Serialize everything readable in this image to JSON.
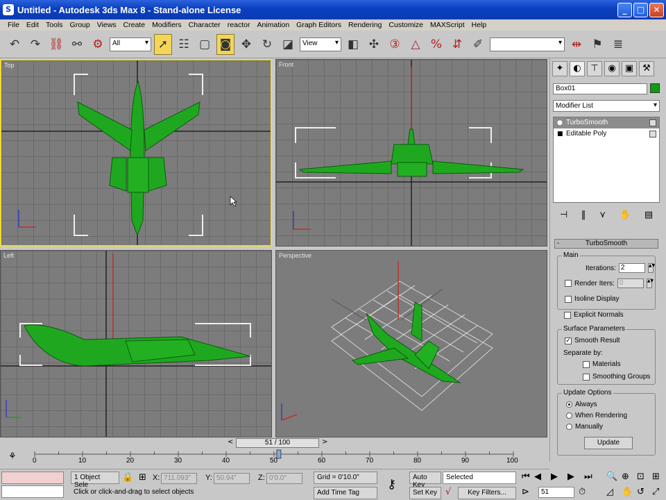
{
  "window": {
    "title": "Untitled - Autodesk 3ds Max 8 - Stand-alone License",
    "minimize": "_",
    "maximize": "□",
    "close": "✕"
  },
  "menu": [
    "File",
    "Edit",
    "Tools",
    "Group",
    "Views",
    "Create",
    "Modifiers",
    "Character",
    "reactor",
    "Animation",
    "Graph Editors",
    "Rendering",
    "Customize",
    "MAXScript",
    "Help"
  ],
  "toolbar": {
    "selection_filter": "All",
    "reference_coord": "View"
  },
  "viewports": {
    "top": "Top",
    "front": "Front",
    "left": "Left",
    "perspective": "Perspective"
  },
  "command_panel": {
    "object_name": "Box01",
    "object_color": "#139a13",
    "modifier_list": "Modifier List",
    "stack": [
      "TurboSmooth",
      "Editable Poly"
    ],
    "rollout_title": "TurboSmooth",
    "main": {
      "label": "Main",
      "iterations_label": "Iterations:",
      "iterations_value": "2",
      "render_iters_label": "Render Iters:",
      "render_iters_value": "0",
      "isoline_display": "Isoline Display",
      "explicit_normals": "Explicit Normals"
    },
    "surface": {
      "label": "Surface Parameters",
      "smooth_result": "Smooth Result",
      "separate_by": "Separate by:",
      "materials": "Materials",
      "smoothing_groups": "Smoothing Groups"
    },
    "update": {
      "label": "Update Options",
      "always": "Always",
      "when_rendering": "When Rendering",
      "manually": "Manually",
      "update_button": "Update"
    }
  },
  "timeline": {
    "frame": "51 / 100",
    "current": 51,
    "max": 100,
    "ticks": [
      "0",
      "10",
      "20",
      "30",
      "40",
      "50",
      "60",
      "70",
      "80",
      "90",
      "100"
    ]
  },
  "status": {
    "selection": "1 Object Sele",
    "x_label": "X:",
    "x_value": "711.093\"",
    "y_label": "Y:",
    "y_value": "50.94\"",
    "z_label": "Z:",
    "z_value": "0'0.0\"",
    "grid": "Grid = 0'10.0\"",
    "prompt": "Click or click-and-drag to select objects",
    "add_time_tag": "Add Time Tag",
    "auto_key": "Auto Key",
    "set_key": "Set Key",
    "key_mode": "Selected",
    "key_filters": "Key Filters...",
    "frame_field": "51"
  }
}
